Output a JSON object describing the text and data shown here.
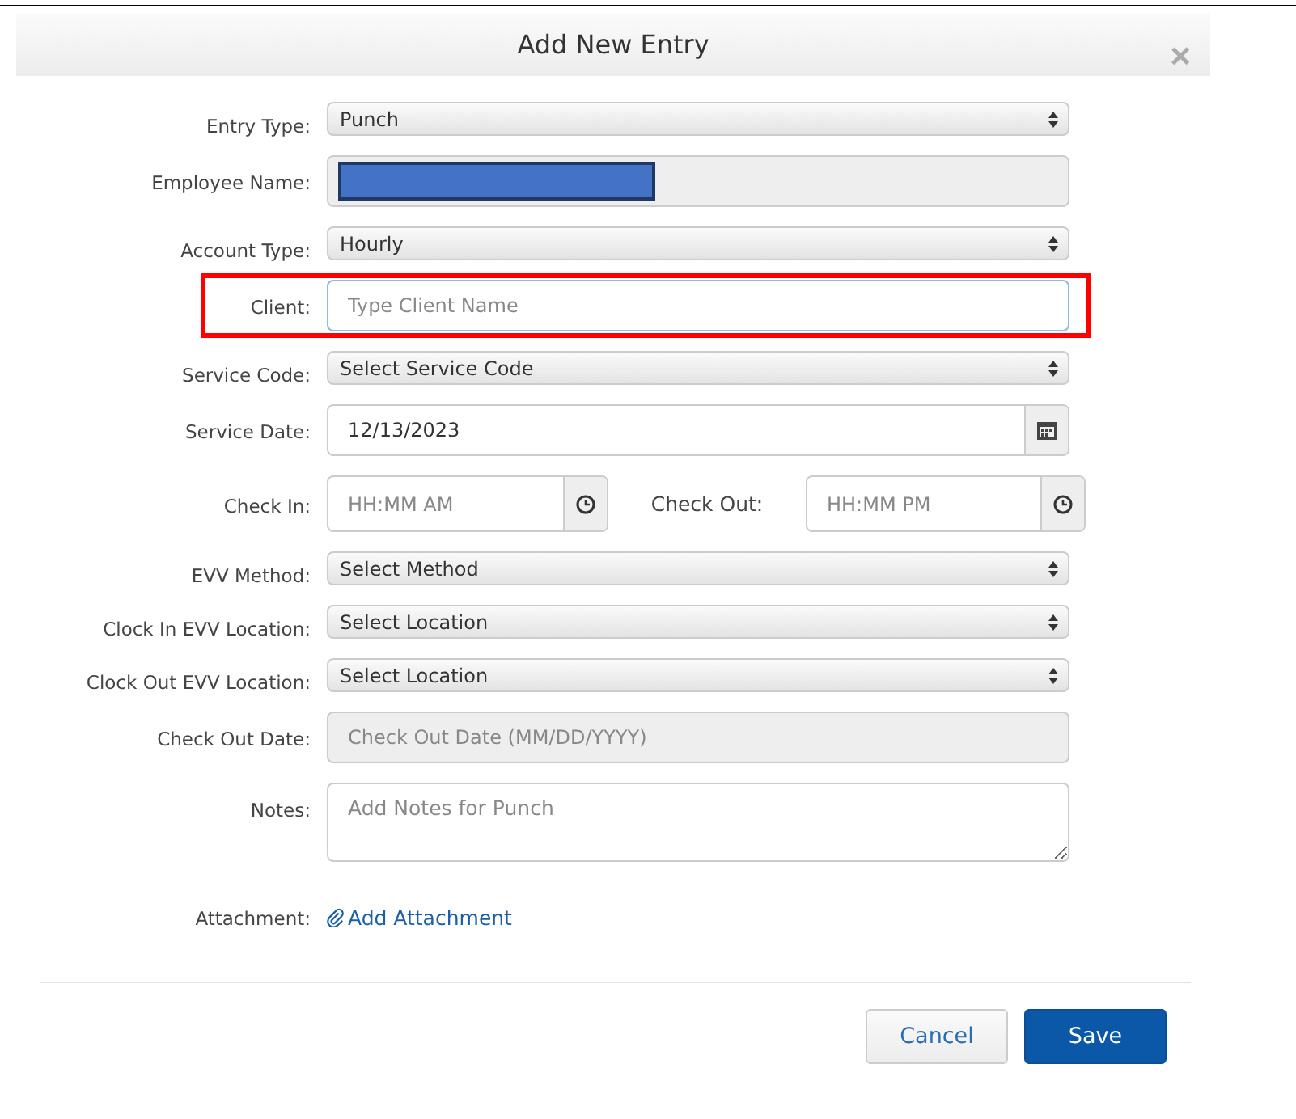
{
  "dialog": {
    "title": "Add New Entry",
    "close": "×"
  },
  "fields": [
    {
      "kind": "select",
      "label": "Entry Type:",
      "value": "Punch"
    },
    {
      "kind": "text",
      "label": "Employee Name:",
      "redacted": true,
      "disabled": true
    },
    {
      "kind": "select",
      "label": "Account Type:",
      "value": "Hourly"
    },
    {
      "kind": "text",
      "label": "Client:",
      "placeholder": "Type Client Name",
      "highlighted": true,
      "disabled": false
    },
    {
      "kind": "select",
      "label": "Service Code:",
      "value": "Select Service Code"
    },
    {
      "kind": "date",
      "label": "Service Date:",
      "value": "12/13/2023"
    },
    {
      "kind": "times",
      "label": "Check In:",
      "placeholder": "HH:MM AM",
      "second_label": "Check Out:",
      "second_placeholder": "HH:MM PM"
    },
    {
      "kind": "select",
      "label": "EVV Method:",
      "value": "Select Method"
    },
    {
      "kind": "select",
      "label": "Clock In EVV Location:",
      "value": "Select Location"
    },
    {
      "kind": "select",
      "label": "Clock Out EVV Location:",
      "value": "Select Location"
    },
    {
      "kind": "text",
      "label": "Check Out Date:",
      "placeholder": "Check Out Date (MM/DD/YYYY)",
      "disabled": true
    },
    {
      "kind": "textarea",
      "label": "Notes:",
      "placeholder": "Add Notes for Punch"
    },
    {
      "kind": "link",
      "label": "Attachment:",
      "value": "Add Attachment"
    }
  ],
  "buttons": [
    {
      "label": "Cancel",
      "primary": false
    },
    {
      "label": "Save",
      "primary": true
    }
  ]
}
